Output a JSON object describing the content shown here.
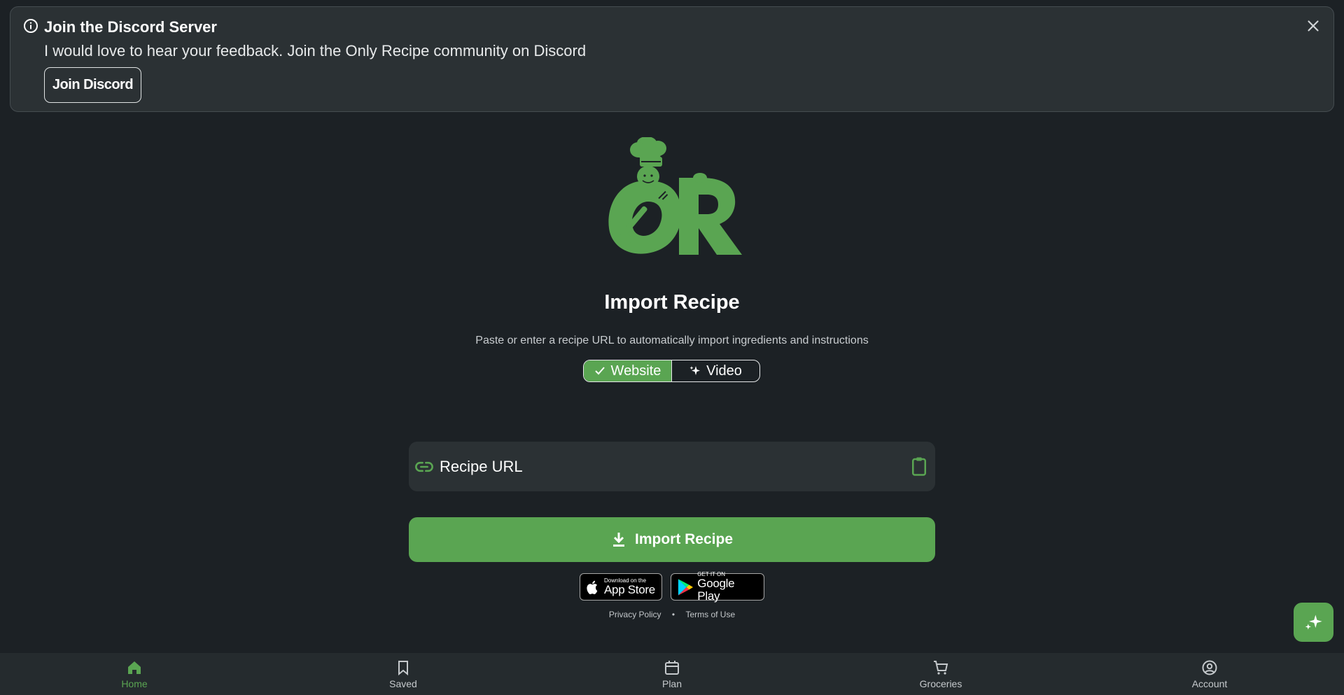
{
  "banner": {
    "title": "Join the Discord Server",
    "message": "I would love to hear your feedback. Join the Only Recipe community on Discord",
    "button_label": "Join Discord"
  },
  "logo": {
    "text": "OR"
  },
  "main": {
    "heading": "Import Recipe",
    "subtitle": "Paste or enter a recipe URL to automatically import ingredients and instructions",
    "toggle": {
      "website_label": "Website",
      "video_label": "Video",
      "selected": "Website"
    },
    "url_input": {
      "placeholder": "Recipe URL",
      "value": ""
    },
    "import_button_label": "Import Recipe"
  },
  "badges": {
    "apple": {
      "small": "Download on the",
      "big": "App Store"
    },
    "google": {
      "small": "GET IT ON",
      "big": "Google Play"
    }
  },
  "legal": {
    "privacy": "Privacy Policy",
    "separator": "•",
    "terms": "Terms of Use"
  },
  "bottom_nav": {
    "items": [
      {
        "label": "Home",
        "icon": "home-icon",
        "active": true
      },
      {
        "label": "Saved",
        "icon": "bookmark-icon",
        "active": false
      },
      {
        "label": "Plan",
        "icon": "calendar-icon",
        "active": false
      },
      {
        "label": "Groceries",
        "icon": "cart-icon",
        "active": false
      },
      {
        "label": "Account",
        "icon": "account-icon",
        "active": false
      }
    ]
  },
  "colors": {
    "accent": "#5aa552",
    "background": "#1c2125",
    "surface": "#2b3134"
  }
}
